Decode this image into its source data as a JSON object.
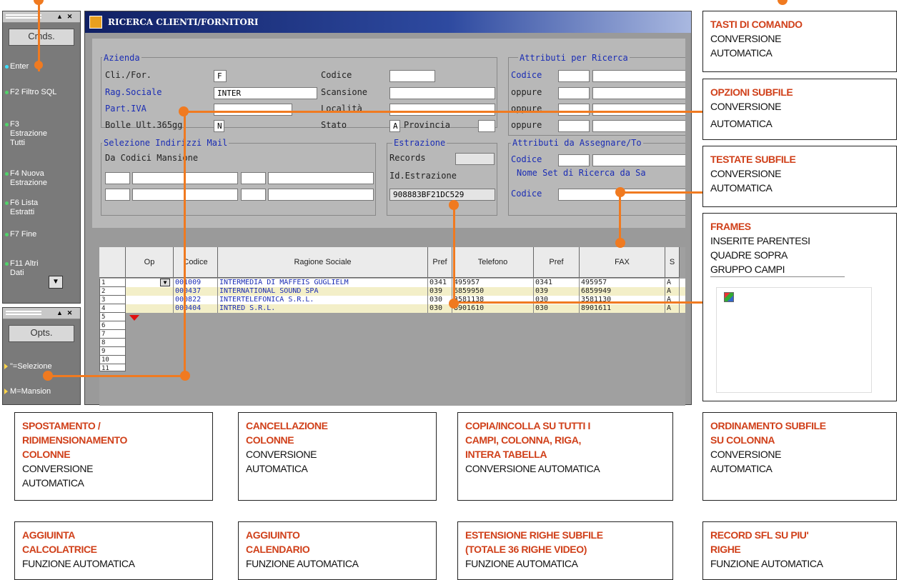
{
  "cmds_panel": {
    "button": "Cmds.",
    "items": [
      "Enter",
      "F2 Filtro SQL",
      "F3 Estrazione Tutti",
      "F4 Nuova Estrazione",
      "F6 Lista Estratti",
      "F7 Fine",
      "F11 Altri Dati"
    ]
  },
  "opts_panel": {
    "button": "Opts.",
    "items": [
      "\"=Selezione",
      "M=Mansion"
    ]
  },
  "window": {
    "title": "RICERCA CLIENTI/FORNITORI",
    "azienda": {
      "frame": "Azienda",
      "cli_for_label": "Cli./For.",
      "cli_for_value": "F",
      "codice_label": "Codice",
      "codice_value": "",
      "rag_sociale_label": "Rag.Sociale",
      "rag_sociale_value": "INTER",
      "scansione_label": "Scansione",
      "scansione_value": "",
      "piva_label": "Part.IVA",
      "piva_value": "",
      "localita_label": "Località",
      "localita_value": "",
      "bolle_label": "Bolle Ult.365gg",
      "bolle_value": "N",
      "stato_label": "Stato",
      "stato_value": "A",
      "provincia_label": "Provincia",
      "provincia_value": ""
    },
    "mail": {
      "frame": "Selezione Indirizzi Mail",
      "label": "Da Codici Mansione"
    },
    "estrazione": {
      "frame": "Estrazione",
      "records_label": "Records",
      "records_value": "",
      "id_label": "Id.Estrazione",
      "id_value": "908883BF21DC529"
    },
    "attributi_ricerca": {
      "frame": "Attributi per Ricerca",
      "codice": "Codice",
      "oppure": "oppure"
    },
    "attributi_assegnare": {
      "frame": "Attributi da Assegnare/To"
    },
    "nome_set": {
      "frame": "Nome Set di Ricerca da Sa",
      "codice": "Codice"
    },
    "table": {
      "headers": [
        "Op",
        "Codice",
        "Ragione Sociale",
        "Pref",
        "Telefono",
        "Pref",
        "FAX",
        "S"
      ],
      "rows": [
        {
          "n": "1",
          "codice": "001009",
          "ragione": "INTERMEDIA DI MAFFEIS GUGLIELM",
          "pref": "0341",
          "tel": "495957",
          "pref2": "0341",
          "fax": "495957",
          "s": "A"
        },
        {
          "n": "2",
          "codice": "000437",
          "ragione": "INTERNATIONAL SOUND SPA",
          "pref": "039",
          "tel": "6859950",
          "pref2": "039",
          "fax": "6859949",
          "s": "A"
        },
        {
          "n": "3",
          "codice": "000822",
          "ragione": "INTERTELEFONICA S.R.L.",
          "pref": "030",
          "tel": "3581138",
          "pref2": "030",
          "fax": "3581130",
          "s": "A"
        },
        {
          "n": "4",
          "codice": "000404",
          "ragione": "INTRED S.R.L.",
          "pref": "030",
          "tel": "8901610",
          "pref2": "030",
          "fax": "8901611",
          "s": "A"
        }
      ],
      "empty_rows": [
        "5",
        "6",
        "7",
        "8",
        "9",
        "10",
        "11"
      ]
    }
  },
  "callouts": {
    "tasti": {
      "title": "TASTI DI COMANDO",
      "text": [
        "CONVERSIONE",
        "AUTOMATICA"
      ]
    },
    "opzioni": {
      "title": "OPZIONI SUBFILE",
      "text": [
        "CONVERSIONE",
        "AUTOMATICA"
      ]
    },
    "testate": {
      "title": "TESTATE SUBFILE",
      "text": [
        "CONVERSIONE",
        "AUTOMATICA"
      ]
    },
    "frames": {
      "title": "FRAMES",
      "text": [
        "INSERITE PARENTESI",
        "QUADRE SOPRA",
        "GRUPPO CAMPI"
      ]
    },
    "spostamento": {
      "title": [
        "SPOSTAMENTO /",
        "RIDIMENSIONAMENTO",
        "COLONNE"
      ],
      "text": [
        "CONVERSIONE",
        "AUTOMATICA"
      ]
    },
    "cancellazione": {
      "title": [
        "CANCELLAZIONE",
        "COLONNE"
      ],
      "text": [
        "CONVERSIONE",
        "AUTOMATICA"
      ]
    },
    "copia": {
      "title": [
        "COPIA/INCOLLA SU TUTTI I",
        "CAMPI, COLONNA, RIGA,",
        "INTERA TABELLA"
      ],
      "text": [
        "CONVERSIONE AUTOMATICA"
      ]
    },
    "ordinamento": {
      "title": [
        "ORDINAMENTO SUBFILE",
        "SU COLONNA"
      ],
      "text": [
        "CONVERSIONE",
        "AUTOMATICA"
      ]
    },
    "calcolatrice": {
      "title": [
        "AGGIUINTA",
        "CALCOLATRICE"
      ],
      "text": [
        "FUNZIONE AUTOMATICA"
      ]
    },
    "calendario": {
      "title": [
        "AGGIUINTO",
        "CALENDARIO"
      ],
      "text": [
        "FUNZIONE AUTOMATICA"
      ]
    },
    "estensione": {
      "title": [
        "ESTENSIONE RIGHE SUBFILE",
        "(TOTALE 36 RIGHE VIDEO)"
      ],
      "text": [
        "FUNZIONE AUTOMATICA"
      ]
    },
    "record": {
      "title": [
        "RECORD SFL SU PIU'",
        "RIGHE"
      ],
      "text": [
        "FUNZIONE  AUTOMATICA"
      ]
    }
  },
  "colors": {
    "accent": "#f07a20",
    "title_red": "#d0401a",
    "field_blue": "#1a2cb4"
  }
}
